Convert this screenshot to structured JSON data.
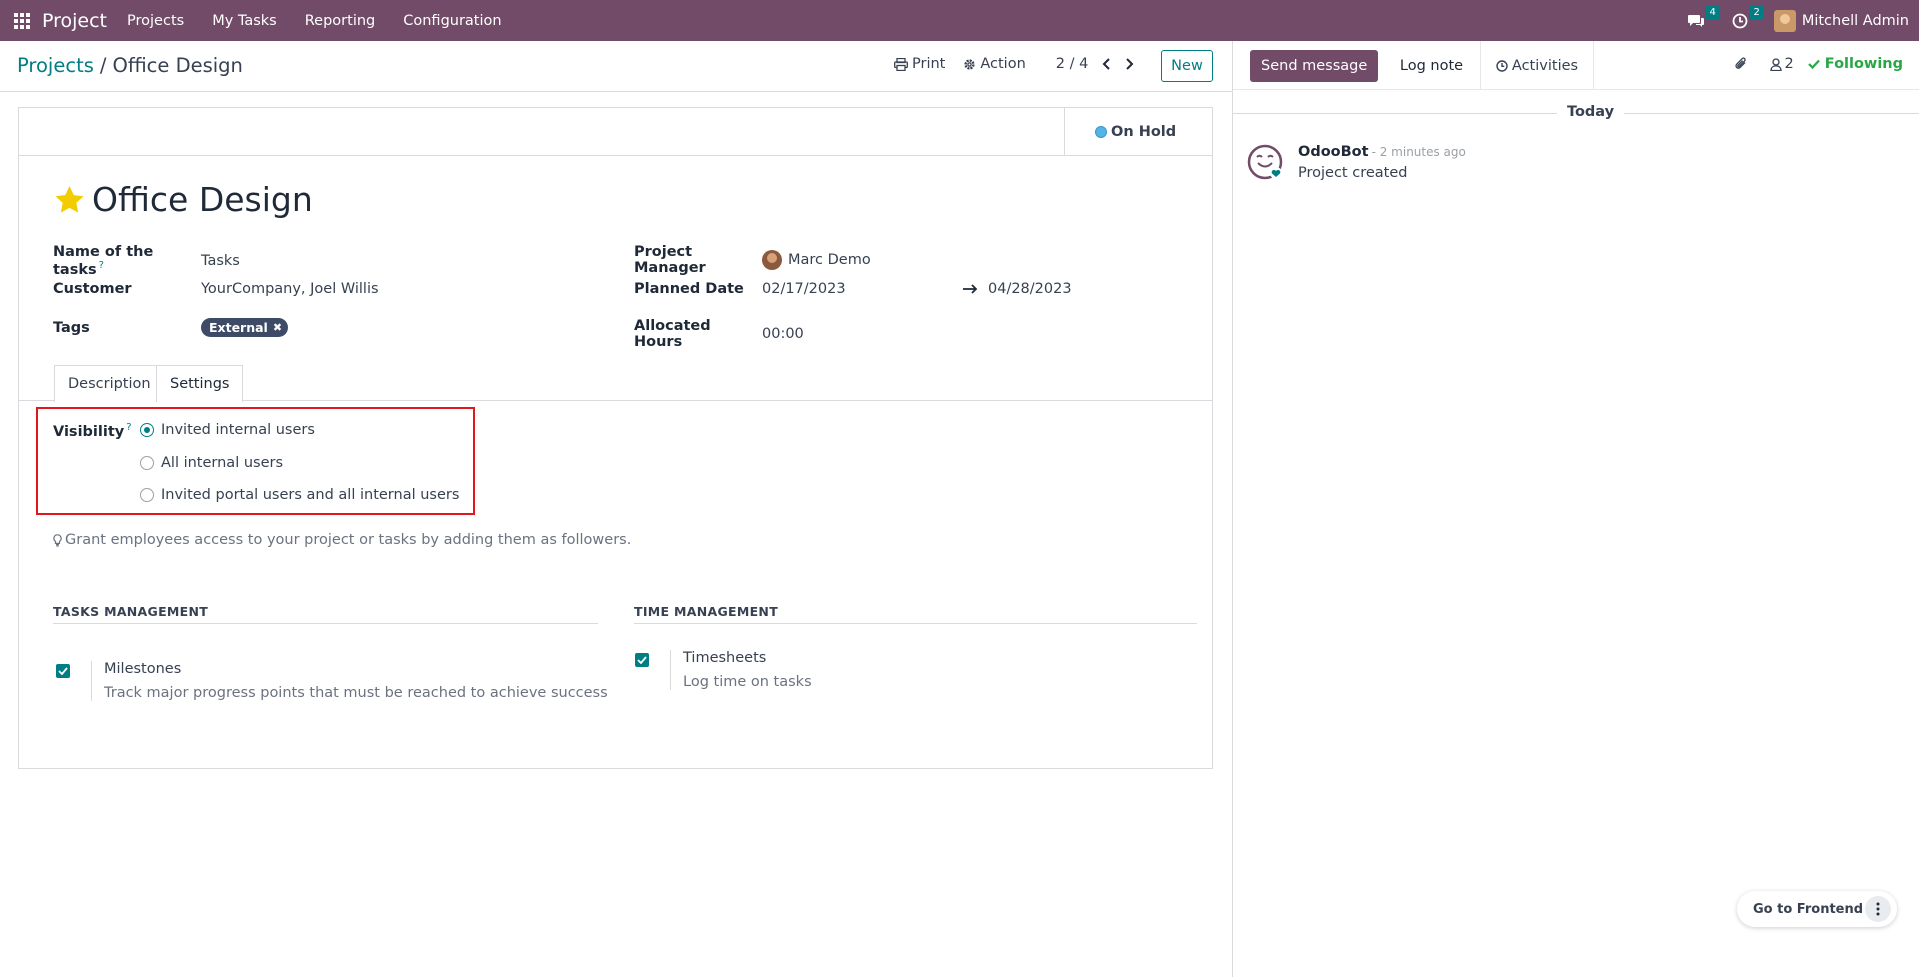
{
  "navbar": {
    "app_name": "Project",
    "menu": [
      "Projects",
      "My Tasks",
      "Reporting",
      "Configuration"
    ],
    "messages_count": "4",
    "activities_count": "2",
    "user_name": "Mitchell Admin"
  },
  "control_panel": {
    "breadcrumb_parent": "Projects",
    "breadcrumb_sep": "/",
    "breadcrumb_current": "Office Design",
    "print_label": "Print",
    "action_label": "Action",
    "pager": "2 / 4",
    "new_label": "New"
  },
  "form": {
    "status": "On Hold",
    "title": "Office Design",
    "fields": {
      "tasks_name_label": "Name of the tasks",
      "tasks_name_value": "Tasks",
      "customer_label": "Customer",
      "customer_value": "YourCompany, Joel Willis",
      "tags_label": "Tags",
      "tag_value": "External",
      "manager_label": "Project Manager",
      "manager_value": "Marc Demo",
      "planned_label": "Planned Date",
      "planned_start": "02/17/2023",
      "planned_end": "04/28/2023",
      "hours_label": "Allocated Hours",
      "hours_value": "00:00",
      "help_mark": "?"
    },
    "tabs": [
      "Description",
      "Settings"
    ],
    "visibility": {
      "label": "Visibility",
      "options": [
        "Invited internal users",
        "All internal users",
        "Invited portal users and all internal users"
      ],
      "selected": "Invited internal users"
    },
    "hint": "Grant employees access to your project or tasks by adding them as followers.",
    "tasks_section": {
      "title": "TASKS MANAGEMENT",
      "setting_title": "Milestones",
      "setting_desc": "Track major progress points that must be reached to achieve success"
    },
    "time_section": {
      "title": "TIME MANAGEMENT",
      "setting_title": "Timesheets",
      "setting_desc": "Log time on tasks"
    }
  },
  "chatter": {
    "send_message": "Send message",
    "log_note": "Log note",
    "activities": "Activities",
    "followers_count": "2",
    "following": "Following",
    "date_separator": "Today",
    "message": {
      "author": "OdooBot",
      "time": "- 2 minutes ago",
      "body": "Project created"
    }
  },
  "frontend_button": "Go to Frontend",
  "colors": {
    "brand": "#714b67",
    "accent": "#017e84",
    "highlight": "#e3161c",
    "following": "#28a745"
  }
}
